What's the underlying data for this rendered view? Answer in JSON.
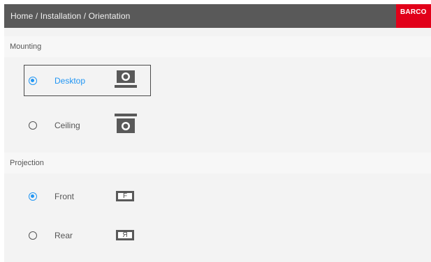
{
  "header": {
    "breadcrumb": "Home / Installation / Orientation",
    "logo": "BARCO"
  },
  "mounting": {
    "title": "Mounting",
    "options": [
      {
        "label": "Desktop",
        "selected": true,
        "icon": "projector-desktop-icon"
      },
      {
        "label": "Ceiling",
        "selected": false,
        "icon": "projector-ceiling-icon"
      }
    ]
  },
  "projection": {
    "title": "Projection",
    "options": [
      {
        "label": "Front",
        "selected": true,
        "icon_glyph": "F"
      },
      {
        "label": "Rear",
        "selected": false,
        "icon_glyph": "Я"
      }
    ]
  },
  "colors": {
    "header_bg": "#595959",
    "logo_bg": "#e10019",
    "accent": "#2196f3",
    "panel_bg": "#f3f3f3"
  }
}
